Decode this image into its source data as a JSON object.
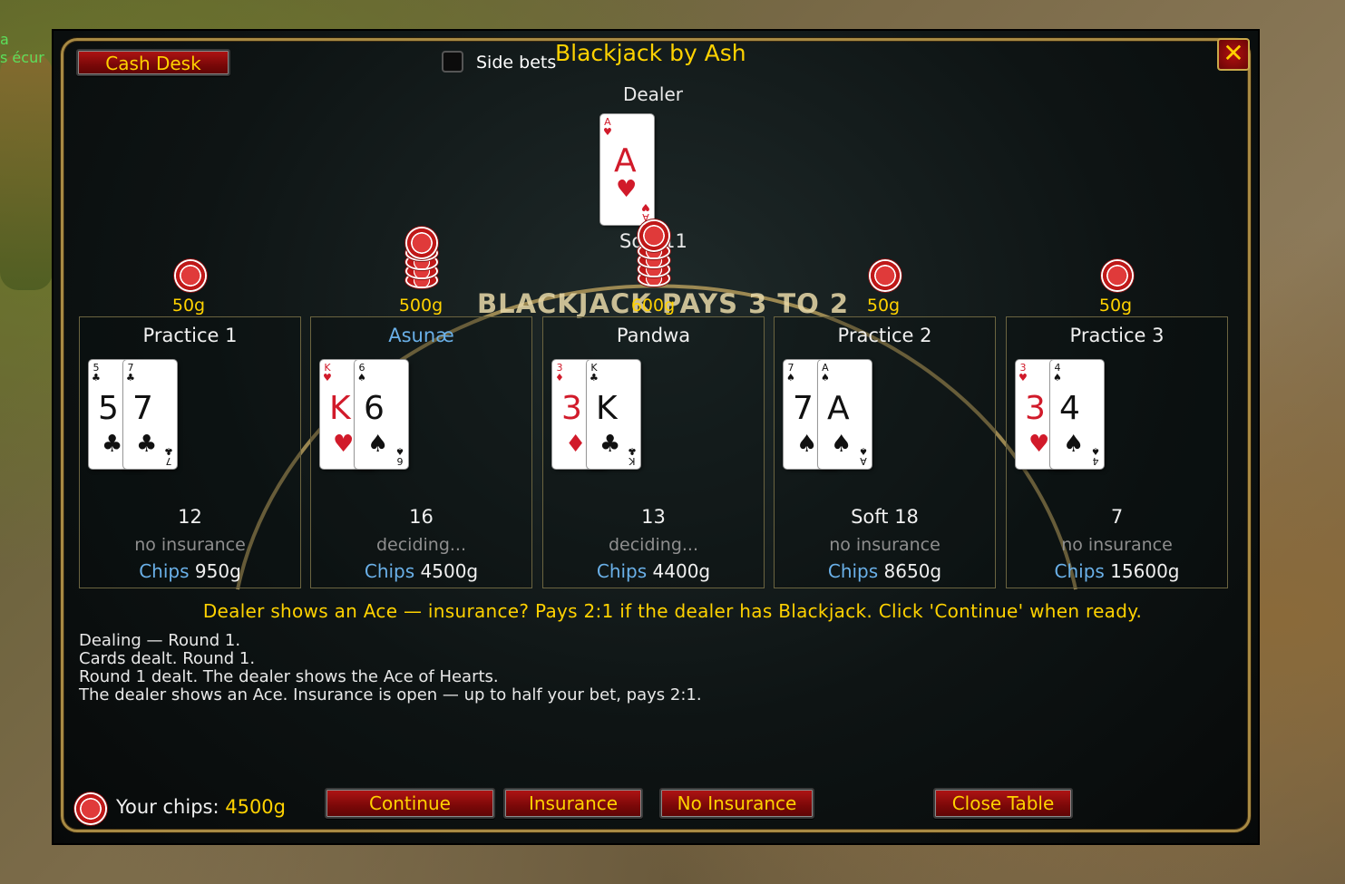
{
  "window": {
    "title": "Blackjack by Ash",
    "close_glyph": "✕"
  },
  "toolbar": {
    "cash_desk_label": "Cash Desk",
    "side_bets_label": "Side bets",
    "side_bets_checked": false
  },
  "background_text": {
    "line1": "a",
    "line2": "s écur"
  },
  "table": {
    "banner": "BLACKJACK PAYS 3 TO 2",
    "dealer": {
      "label": "Dealer",
      "score": "Soft 11",
      "bet": "600g",
      "cards": [
        {
          "rank": "A",
          "suit": "♥",
          "color": "red"
        },
        {
          "rank": "",
          "suit": "",
          "color": "hidden"
        }
      ]
    },
    "seats": [
      {
        "name": "Practice 1",
        "name_color": "#f0f0f0",
        "bet": "50g",
        "cards": [
          {
            "rank": "5",
            "suit": "♣",
            "color": "blk"
          },
          {
            "rank": "7",
            "suit": "♣",
            "color": "blk"
          }
        ],
        "total": "12",
        "status": "no insurance",
        "chips_word": "Chips",
        "chips": "950g"
      },
      {
        "name": "Asunæ",
        "name_color": "#6ab0e8",
        "bet": "500g",
        "cards": [
          {
            "rank": "K",
            "suit": "♥",
            "color": "red"
          },
          {
            "rank": "6",
            "suit": "♠",
            "color": "blk"
          }
        ],
        "total": "16",
        "status": "deciding...",
        "chips_word": "Chips",
        "chips": "4500g"
      },
      {
        "name": "Pandwa",
        "name_color": "#f0f0f0",
        "bet": "600g",
        "cards": [
          {
            "rank": "3",
            "suit": "♦",
            "color": "red"
          },
          {
            "rank": "K",
            "suit": "♣",
            "color": "blk"
          }
        ],
        "total": "13",
        "status": "deciding...",
        "chips_word": "Chips",
        "chips": "4400g"
      },
      {
        "name": "Practice 2",
        "name_color": "#f0f0f0",
        "bet": "50g",
        "cards": [
          {
            "rank": "7",
            "suit": "♠",
            "color": "blk"
          },
          {
            "rank": "A",
            "suit": "♠",
            "color": "blk"
          }
        ],
        "total": "Soft 18",
        "status": "no insurance",
        "chips_word": "Chips",
        "chips": "8650g"
      },
      {
        "name": "Practice 3",
        "name_color": "#f0f0f0",
        "bet": "50g",
        "cards": [
          {
            "rank": "3",
            "suit": "♥",
            "color": "red"
          },
          {
            "rank": "4",
            "suit": "♠",
            "color": "blk"
          }
        ],
        "total": "7",
        "status": "no insurance",
        "chips_word": "Chips",
        "chips": "15600g"
      }
    ]
  },
  "prompt": "Dealer shows an Ace — insurance? Pays 2:1 if the dealer has Blackjack. Click 'Continue' when ready.",
  "log": [
    "Dealing — Round 1.",
    "Cards dealt. Round 1.",
    "Round 1 dealt. The dealer shows the Ace of Hearts.",
    "The dealer shows an Ace. Insurance is open — up to half your bet, pays 2:1."
  ],
  "footer": {
    "your_chips_label": "Your chips: ",
    "your_chips_value": "4500g",
    "continue_label": "Continue",
    "insurance_label": "Insurance",
    "no_insurance_label": "No Insurance",
    "close_table_label": "Close Table"
  },
  "colors": {
    "accent_gold": "#ffd200",
    "chips_blue": "#6ab0e8",
    "button_red": "#8a0a0a",
    "frame_gold": "#a88a44"
  }
}
